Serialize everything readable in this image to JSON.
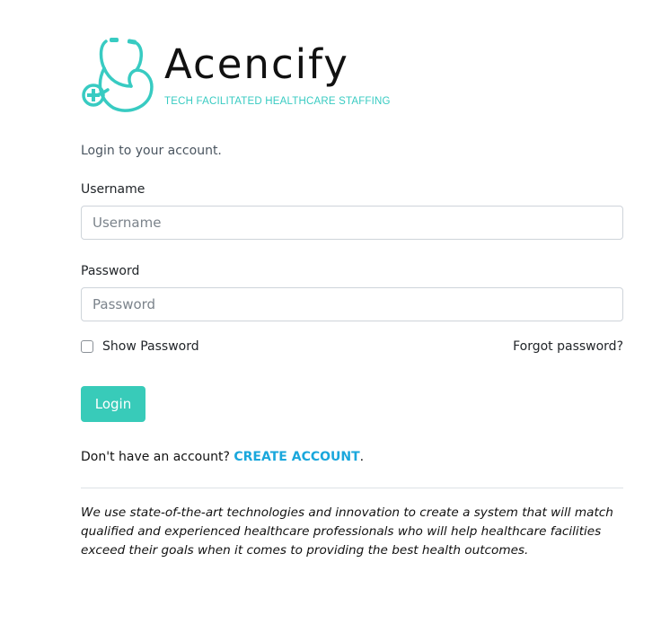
{
  "brand": {
    "name": "Acencify",
    "tagline": "TECH FACILITATED HEALTHCARE STAFFING",
    "accent_color": "#38cbc2",
    "icon": "stethoscope-icon"
  },
  "login": {
    "intro": "Login to your account.",
    "username_label": "Username",
    "username_placeholder": "Username",
    "password_label": "Password",
    "password_placeholder": "Password",
    "show_password_label": "Show Password",
    "show_password_checked": false,
    "forgot_password": "Forgot password?",
    "submit_label": "Login",
    "button_color": "#38cbb9"
  },
  "signup": {
    "prompt": "Don't have an account?",
    "link_label": "CREATE ACCOUNT",
    "suffix": ".",
    "link_color": "#1aa7dc"
  },
  "footer": {
    "description": "We use state-of-the-art technologies and innovation to create a system that will match qualified and experienced healthcare professionals who will help healthcare facilities exceed their goals when it comes to providing the best health outcomes."
  }
}
